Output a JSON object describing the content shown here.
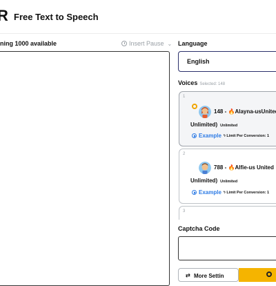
{
  "app": {
    "logo_letter": "R",
    "title": "Free Text to Speech"
  },
  "editor": {
    "remaining_text": "ning 1000 available",
    "insert_pause_label": "Insert Pause",
    "chevron": "⌄"
  },
  "language": {
    "label": "Language",
    "selected": "English"
  },
  "voices": {
    "label": "Voices",
    "selected_text": "Selected: 148",
    "cards": [
      {
        "index": "1",
        "name": "148 - ",
        "voice": "Alayna-usUnited",
        "unlimited_line": "Unlimited)",
        "badge": "Unlimited",
        "example": "Example",
        "limit": "Limit Per Conversion: 1",
        "selected": true,
        "icon": "flame-icon"
      },
      {
        "index": "2",
        "name": "788 - ",
        "voice": "Alfie-us United",
        "unlimited_line": "Unlimited)",
        "badge": "Unlimited",
        "example": "Example",
        "limit": "Limit Per Conversion: 1",
        "selected": false,
        "icon": "flame-icon"
      },
      {
        "index": "3"
      }
    ]
  },
  "captcha": {
    "label": "Captcha Code",
    "value": ""
  },
  "buttons": {
    "more_settings": "More Settin",
    "more_icon": "⇄"
  },
  "colors": {
    "accent_orange": "#f5b400",
    "link_blue": "#2d7be5",
    "select_border": "#2a2f6a"
  }
}
